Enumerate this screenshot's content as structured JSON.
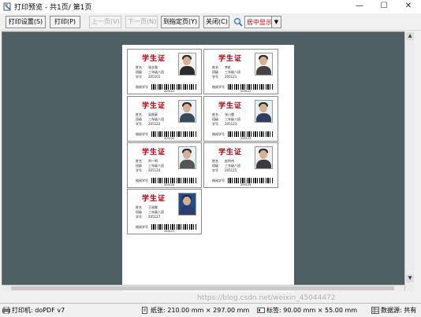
{
  "window": {
    "title": "打印预览 - 共1页/ 第1页",
    "controls": [
      "—",
      "☐",
      "✕"
    ]
  },
  "toolbar": {
    "print_setup": "打印设置(S)",
    "print": "打印(P)",
    "prev_page": "上一页(V)",
    "next_page": "下一页(N)",
    "goto_page": "到指定页(Y)",
    "close": "关闭(C)",
    "zoom_value": "居中显示"
  },
  "cards": [
    {
      "title": "学生证",
      "name_label": "姓名",
      "name": "张志强",
      "class_label": "班级",
      "class": "三年级八班",
      "id_label": "学号",
      "id": "205101",
      "code_label": "借阅学号",
      "code": "205101"
    },
    {
      "title": "学生证",
      "name_label": "姓名",
      "name": "李虹",
      "class_label": "班级",
      "class": "三年级八班",
      "id_label": "学号",
      "id": "205121",
      "code_label": "借阅学号",
      "code": "205121"
    },
    {
      "title": "学生证",
      "name_label": "姓名",
      "name": "吴俊豪",
      "class_label": "班级",
      "class": "三年级八班",
      "id_label": "学号",
      "id": "205122",
      "code_label": "借阅学号",
      "code": "205122"
    },
    {
      "title": "学生证",
      "name_label": "姓名",
      "name": "张小雷",
      "class_label": "班级",
      "class": "三年级八班",
      "id_label": "学号",
      "id": "205123",
      "code_label": "借阅学号",
      "code": "205123"
    },
    {
      "title": "学生证",
      "name_label": "姓名",
      "name": "刘一鸣",
      "class_label": "班级",
      "class": "三年级八班",
      "id_label": "学号",
      "id": "205124",
      "code_label": "借阅学号",
      "code": "205124"
    },
    {
      "title": "学生证",
      "name_label": "姓名",
      "name": "赵利伟",
      "class_label": "班级",
      "class": "三年级八班",
      "id_label": "学号",
      "id": "205125",
      "code_label": "借阅学号",
      "code": "205125"
    },
    {
      "title": "学生证",
      "name_label": "姓名",
      "name": "王丽娜",
      "class_label": "班级",
      "class": "三年级八班",
      "id_label": "学号",
      "id": "205127",
      "code_label": "借阅学号",
      "code": "205127"
    }
  ],
  "status": {
    "printer": "打印机: doPDF v7",
    "paper": "纸张: 210.00 mm × 297.00 mm",
    "label": "标签: 90.00 mm × 55.00 mm",
    "data": "数据源: 共有"
  },
  "watermark": "https://blog.csdn.net/weixin_45044472",
  "colors": {
    "accent": "#b0000f",
    "preview_bg": "#4f6064"
  }
}
